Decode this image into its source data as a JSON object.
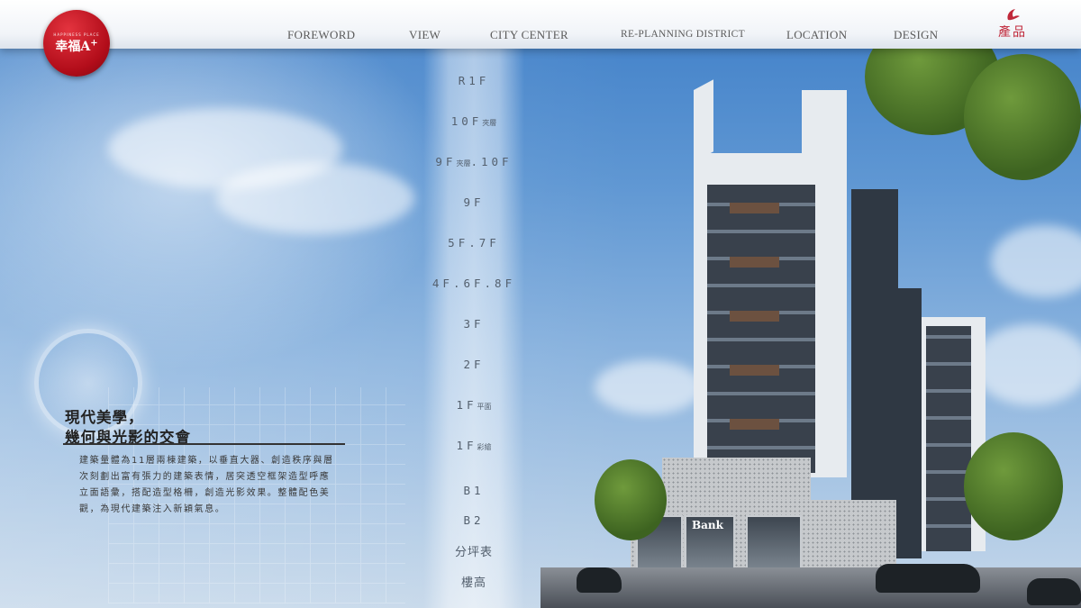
{
  "logo": {
    "small_text": "HAPPINESS PLACE",
    "brand": "幸福A",
    "sup": "+"
  },
  "nav": {
    "items": [
      {
        "label": "FOREWORD"
      },
      {
        "label": "VIEW"
      },
      {
        "label": "CITY CENTER"
      },
      {
        "label": "RE-PLANNING DISTRICT"
      },
      {
        "label": "LOCATION"
      },
      {
        "label": "DESIGN"
      }
    ],
    "product_label": "產品"
  },
  "floors": [
    {
      "label": "R1F",
      "sub": ""
    },
    {
      "label": "10F",
      "sub": "夾層"
    },
    {
      "label": "9F",
      "sub": "夾層",
      "tail": ".10F"
    },
    {
      "label": "9F",
      "sub": ""
    },
    {
      "label": "5F.7F",
      "sub": ""
    },
    {
      "label": "4F.6F.8F",
      "sub": ""
    },
    {
      "label": "3F",
      "sub": ""
    },
    {
      "label": "2F",
      "sub": ""
    },
    {
      "label": "1F",
      "sub": "平面"
    },
    {
      "label": "1F",
      "sub": "彩繪"
    },
    {
      "label": "B1",
      "sub": ""
    },
    {
      "label": "B2",
      "sub": ""
    },
    {
      "label": "分坪表",
      "sub": ""
    },
    {
      "label": "樓高",
      "sub": ""
    }
  ],
  "content": {
    "headline_1": "現代美學，",
    "headline_2": "幾何與光影的交會",
    "body_1": "建築量體為11層兩棟建築，以垂直大器、創造秩序與層",
    "body_2": "次刻劃出富有張力的建築表情，居突透空框架造型呼應",
    "body_3": "立面語彙，搭配造型格柵，創造光影效果。整體配色美",
    "body_4": "觀，為現代建築注入新穎氣息。"
  },
  "scene": {
    "bank_sign": "Bank"
  },
  "colors": {
    "brand_red": "#b20d1a",
    "accent_red": "#c0283a",
    "nav_text": "#5a5a5a"
  }
}
